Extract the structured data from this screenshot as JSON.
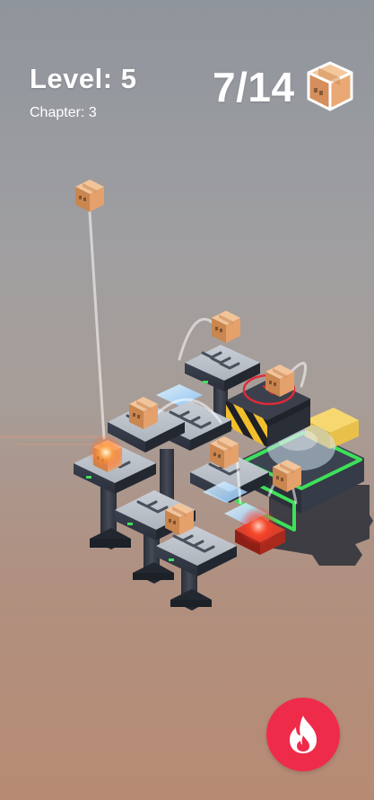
{
  "hud": {
    "level_label": "Level: 5",
    "chapter_label": "Chapter: 3",
    "box_count": "7/14"
  },
  "controls": {
    "fire_button_icon": "flame-icon"
  },
  "colors": {
    "fire_button": "#ee2c4a",
    "highlight_green": "#3ee05a",
    "target_red": "#e02a38",
    "warning_yellow": "#f4c430"
  }
}
